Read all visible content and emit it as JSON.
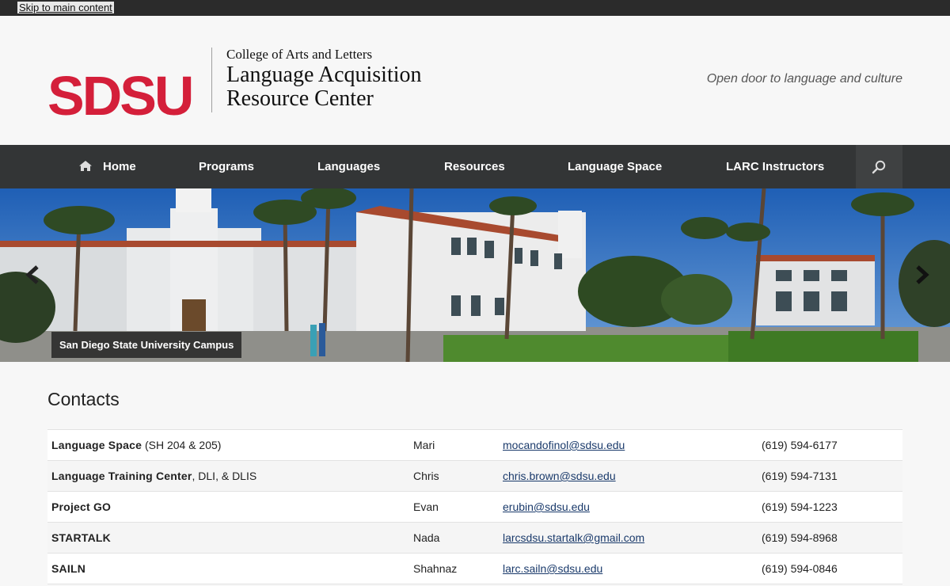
{
  "skip_link": "Skip to main content",
  "header": {
    "logo": "SDSU",
    "college": "College of Arts and Letters",
    "center_name": "Language Acquisition Resource Center",
    "tagline": "Open door to language and culture"
  },
  "nav": {
    "items": [
      {
        "label": "Home",
        "icon": "home-icon"
      },
      {
        "label": "Programs"
      },
      {
        "label": "Languages"
      },
      {
        "label": "Resources"
      },
      {
        "label": "Language Space"
      },
      {
        "label": "LARC Instructors"
      }
    ],
    "search_icon": "search-icon"
  },
  "hero": {
    "caption": "San Diego State University Campus",
    "prev_icon": "chevron-left-icon",
    "next_icon": "chevron-right-icon"
  },
  "contacts": {
    "title": "Contacts",
    "rows": [
      {
        "program_bold": "Language Space",
        "program_rest": " (SH 204 & 205)",
        "name": "Mari",
        "email": "mocandofinol@sdsu.edu",
        "phone": "(619) 594-6177"
      },
      {
        "program_bold": "Language Training Center",
        "program_rest": ", DLI, & DLIS",
        "name": "Chris",
        "email": "chris.brown@sdsu.edu",
        "phone": "(619) 594-7131"
      },
      {
        "program_bold": "Project GO",
        "program_rest": "",
        "name": "Evan",
        "email": "erubin@sdsu.edu",
        "phone": "(619) 594-1223"
      },
      {
        "program_bold": "STARTALK",
        "program_rest": "",
        "name": "Nada",
        "email": "larcsdsu.startalk@gmail.com",
        "phone": "(619) 594-8968"
      },
      {
        "program_bold": "SAILN",
        "program_rest": "",
        "name": "Shahnaz",
        "email": "larc.sailn@sdsu.edu",
        "phone": "(619) 594-0846"
      }
    ]
  }
}
